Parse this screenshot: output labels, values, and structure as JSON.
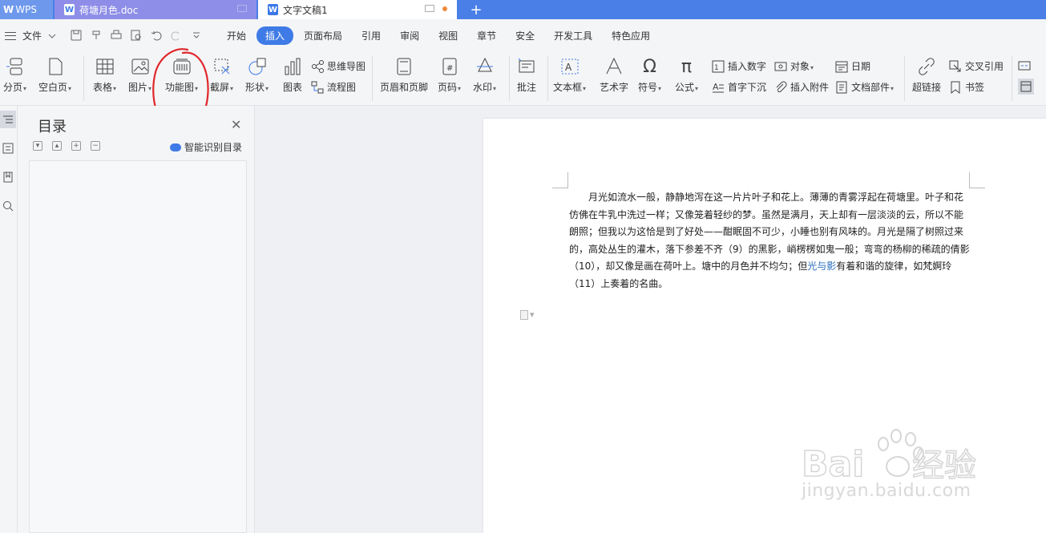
{
  "tabs": {
    "wps_label": "WPS",
    "doc1_title": "荷塘月色.doc",
    "doc2_title": "文字文稿1",
    "new_tab": "+"
  },
  "menubar": {
    "file_label": "文件",
    "items": [
      "开始",
      "插入",
      "页面布局",
      "引用",
      "审阅",
      "视图",
      "章节",
      "安全",
      "开发工具",
      "特色应用"
    ],
    "active": "插入"
  },
  "ribbon": {
    "page_break": "分页",
    "blank_page": "空白页",
    "table": "表格",
    "picture": "图片",
    "function_chart": "功能图",
    "screenshot": "截屏",
    "shapes": "形状",
    "chart": "图表",
    "mindmap": "思维导图",
    "flowchart": "流程图",
    "header_footer": "页眉和页脚",
    "page_number": "页码",
    "watermark": "水印",
    "comment": "批注",
    "textbox": "文本框",
    "wordart": "艺术字",
    "symbol": "符号",
    "formula": "公式",
    "insert_number": "插入数字",
    "object": "对象",
    "date": "日期",
    "drop_cap": "首字下沉",
    "attachment": "插入附件",
    "doc_parts": "文档部件",
    "hyperlink": "超链接",
    "cross_ref": "交叉引用",
    "bookmark": "书签"
  },
  "outline": {
    "title": "目录",
    "smart_toc": "智能识别目录"
  },
  "document": {
    "part1": "月光如流水一般，静静地泻在这一片片叶子和花上。薄薄的青雾浮起在荷塘里。叶子和花仿佛在牛乳中洗过一样；又像笼着轻纱的梦。虽然是满月，天上却有一层淡淡的云，所以不能朗照；但我以为这恰是到了好处——酣眠固不可少，小睡也别有风味的。月光是隔了树照过来的，高处丛生的灌木，落下参差不齐（9）的黑影，峭楞楞如鬼一般；弯弯的杨柳的稀疏的倩影（10），却又像是画在荷叶上。塘中的月色并不均匀；但",
    "link": "光与影",
    "part2": "有着和谐的旋律，如梵婀玲（11）上奏着的名曲。"
  },
  "watermark": {
    "brand": "Baidu经验",
    "url": "jingyan.baidu.com"
  },
  "colors": {
    "accent": "#3f7be6",
    "tabbar": "#4a7fe8",
    "annotation": "#e0262a"
  }
}
